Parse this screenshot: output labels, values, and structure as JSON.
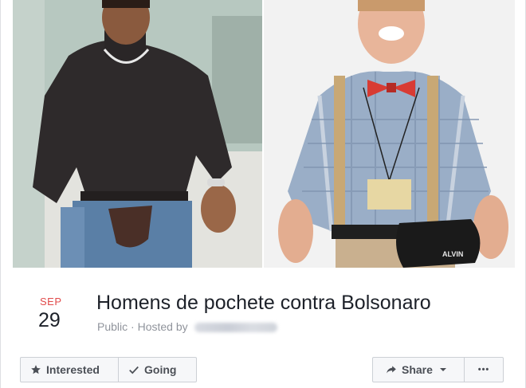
{
  "event": {
    "month": "SEP",
    "day": "29",
    "title": "Homens de pochete contra Bolsonaro",
    "privacy": "Public",
    "hosted_by_label": "Hosted by"
  },
  "cover": {
    "right_photo_bag_text": "ALVIN"
  },
  "actions": {
    "interested_label": "Interested",
    "going_label": "Going",
    "share_label": "Share",
    "more_label": "•••"
  },
  "colors": {
    "date_month": "#e14b4b",
    "button_bg": "#f6f7f9",
    "button_border": "#ccd0d5",
    "meta_text": "#90949c"
  }
}
